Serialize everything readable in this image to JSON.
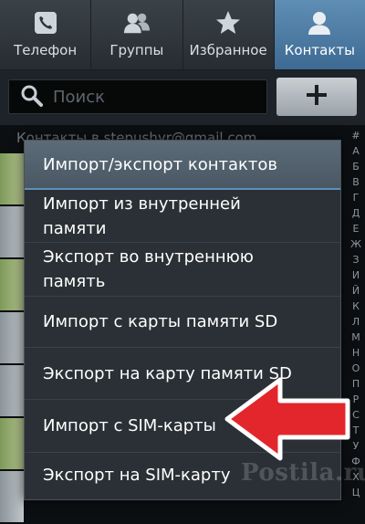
{
  "tabs": [
    {
      "label": "Телефон",
      "icon": "phone-icon",
      "active": false
    },
    {
      "label": "Группы",
      "icon": "group-icon",
      "active": false
    },
    {
      "label": "Избранное",
      "icon": "star-icon",
      "active": false
    },
    {
      "label": "Контакты",
      "icon": "contact-icon",
      "active": true
    }
  ],
  "search": {
    "placeholder": "Поиск",
    "icon": "search-icon",
    "value": ""
  },
  "add_button": {
    "icon": "plus-icon"
  },
  "list": {
    "header": "Контакты в stepushyr@gmail.com"
  },
  "index_letters": [
    "#",
    "А",
    "Б",
    "В",
    "Г",
    "Д",
    "Е",
    "Ж",
    "З",
    "И",
    "Й",
    "К",
    "Л",
    "М",
    "Н",
    "О",
    "П",
    "Р",
    "С",
    "Т",
    "У",
    "Ф",
    "Х",
    "Ц"
  ],
  "menu": {
    "title": "Импорт/экспорт контактов",
    "items": [
      "Импорт из внутренней\nпамяти",
      "Экспорт во внутреннюю\nпамять",
      "Импорт с карты памяти SD",
      "Экспорт на карту памяти SD",
      "Импорт с SIM-карты",
      "Экспорт на SIM-карту"
    ]
  },
  "watermark": "Postila.ru",
  "colors": {
    "active_tab": "#4f7ea6",
    "accent_line": "#5f8fb8",
    "arrow_red": "#e3262b",
    "menu_bg": "#2a3035"
  }
}
